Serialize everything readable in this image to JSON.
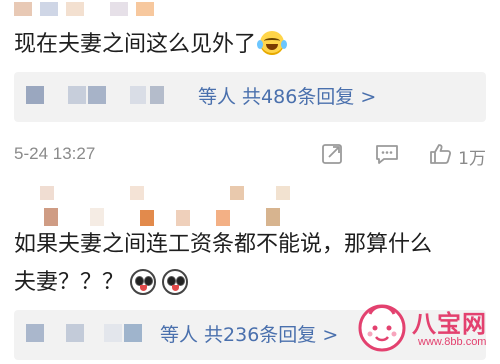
{
  "comments": [
    {
      "text": "现在夫妻之间这么见外了",
      "reply_summary": "等人 共486条回复 >",
      "timestamp": "5-24 13:27",
      "like_count": "1万"
    },
    {
      "text_line1": "如果夫妻之间连工资条都不能说，那算什么",
      "text_line2": "夫妻？？？",
      "reply_summary": "等人 共236条回复 >"
    }
  ],
  "watermark": {
    "brand": "八宝网",
    "url": "www.8bb.com"
  },
  "colors": {
    "link_blue": "#4a70ad",
    "meta_gray": "#8a8a8a",
    "reply_bg": "#f2f2f2",
    "watermark_pink": "#e3416f"
  },
  "icons": [
    "laughing-tears-emoji",
    "share-icon",
    "comment-icon",
    "thumbs-up-icon",
    "shocked-face-emoji"
  ]
}
